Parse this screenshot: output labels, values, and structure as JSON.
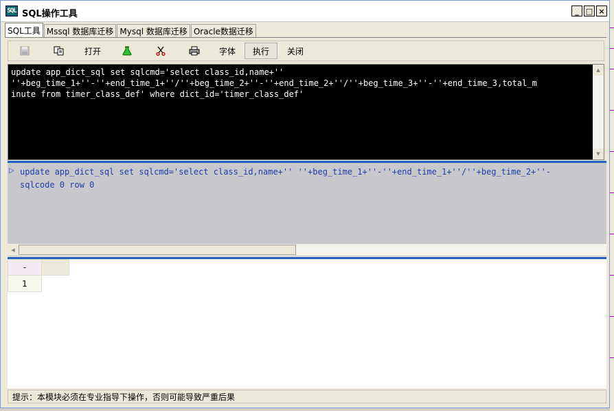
{
  "window": {
    "title": "SQL操作工具",
    "icon_text": "SQL",
    "controls": [
      "_",
      "□",
      "×"
    ]
  },
  "tabs": [
    {
      "label": "SQL工具",
      "active": true
    },
    {
      "label": "Mssql 数据库迁移",
      "active": false
    },
    {
      "label": "Mysql 数据库迁移",
      "active": false
    },
    {
      "label": "Oracle数据迁移",
      "active": false
    }
  ],
  "toolbar": {
    "open_label": "打开",
    "font_label": "字体",
    "execute_label": "执行",
    "close_label": "关闭",
    "icons": [
      "save-icon",
      "copy-icon",
      "flask-icon",
      "cut-icon",
      "print-icon"
    ]
  },
  "editor": {
    "sql_text": "update app_dict_sql set sqlcmd='select class_id,name+''\n''+beg_time_1+''-''+end_time_1+''/''+beg_time_2+''-''+end_time_2+''/''+beg_time_3+''-''+end_time_3,total_m\ninute from timer_class_def' where dict_id='timer_class_def'"
  },
  "log": {
    "text": "update app_dict_sql set sqlcmd='select class_id,name+'' ''+beg_time_1+''-''+end_time_1+''/''+beg_time_2+''-\nsqlcode 0 row 0"
  },
  "grid": {
    "header": "-",
    "rows": [
      "1"
    ]
  },
  "status": {
    "text": "提示：本模块必须在专业指导下操作，否则可能导致严重后果"
  },
  "colors": {
    "editor_bg": "#000000",
    "log_bg": "#c8c8cc",
    "splitter": "#2060c0"
  }
}
